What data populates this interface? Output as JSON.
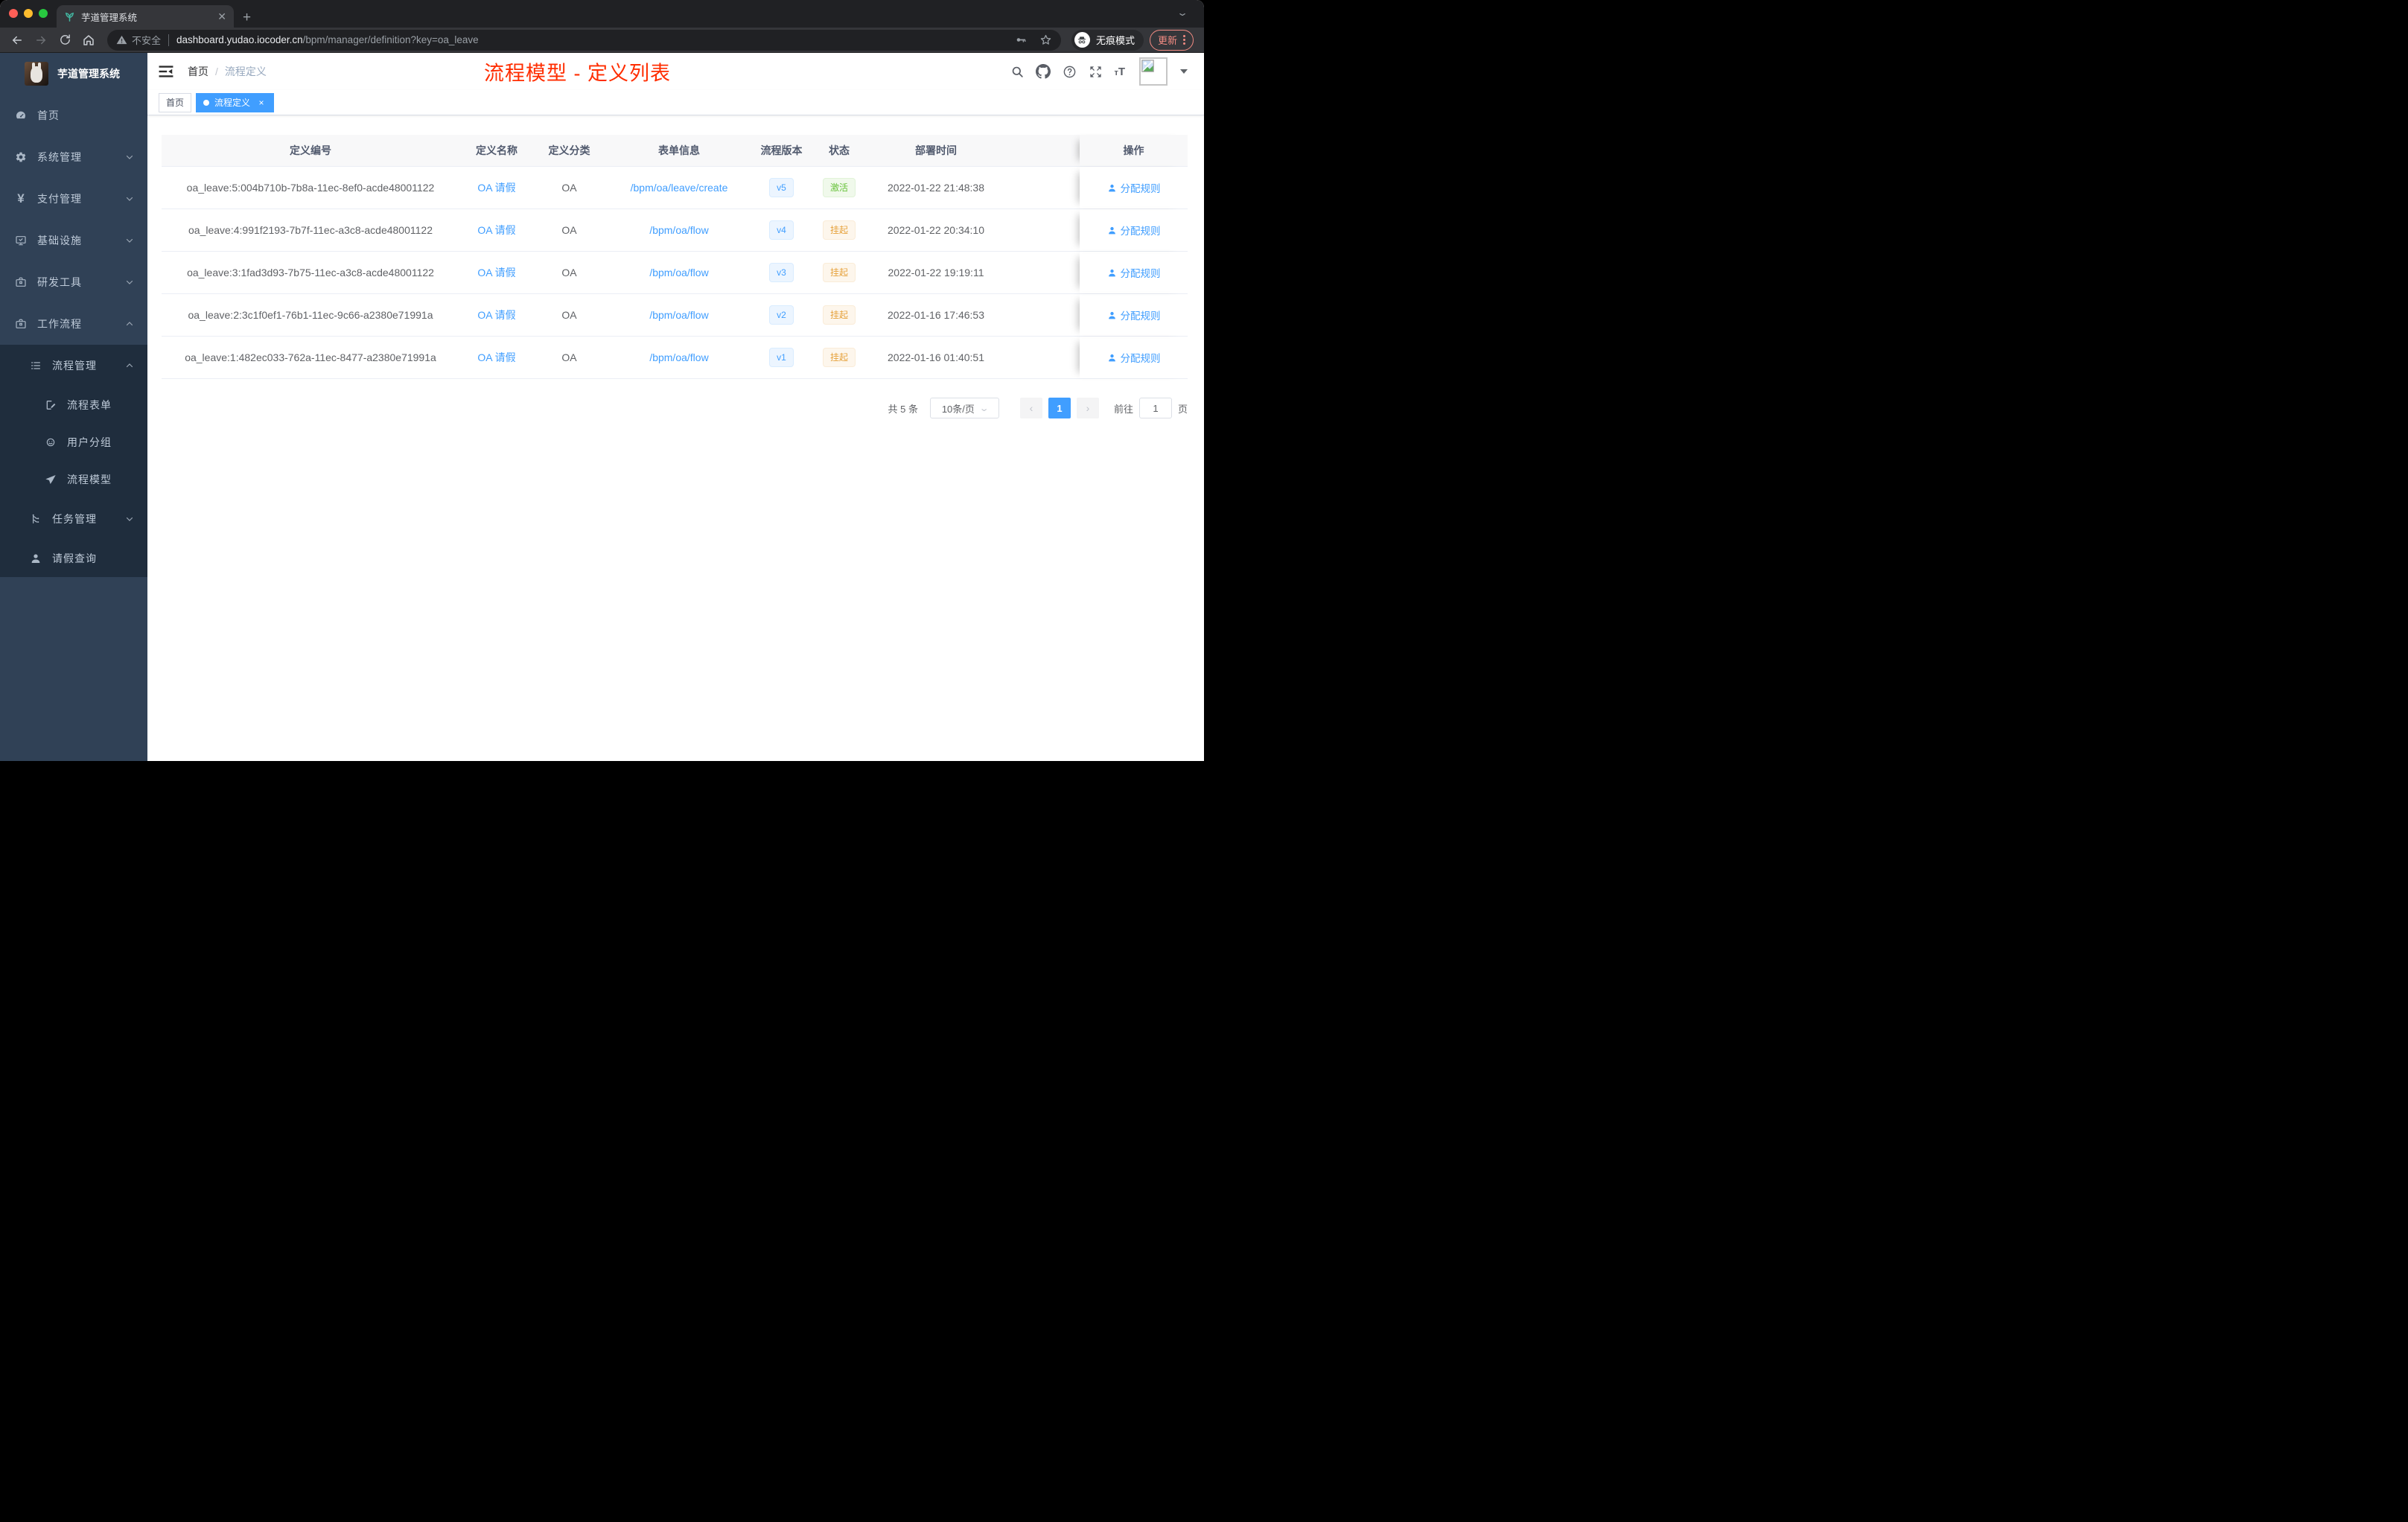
{
  "browser": {
    "tab_title": "芋道管理系统",
    "new_tab": "+",
    "security_label": "不安全",
    "url_domain": "dashboard.yudao.iocoder.cn",
    "url_path": "/bpm/manager/definition?key=oa_leave",
    "incognito_label": "无痕模式",
    "update_label": "更新"
  },
  "sidebar": {
    "logo_title": "芋道管理系统",
    "items": [
      {
        "label": "首页",
        "icon": "dashboard-icon",
        "chevron": ""
      },
      {
        "label": "系统管理",
        "icon": "gear-icon",
        "chevron": "down"
      },
      {
        "label": "支付管理",
        "icon": "yen-icon",
        "chevron": "down"
      },
      {
        "label": "基础设施",
        "icon": "monitor-icon",
        "chevron": "down"
      },
      {
        "label": "研发工具",
        "icon": "toolbox-icon",
        "chevron": "down"
      },
      {
        "label": "工作流程",
        "icon": "briefcase-icon",
        "chevron": "up"
      },
      {
        "label": "流程管理",
        "icon": "list-icon",
        "chevron": "up"
      },
      {
        "label": "流程表单",
        "icon": "form-icon",
        "chevron": ""
      },
      {
        "label": "用户分组",
        "icon": "user-group-icon",
        "chevron": ""
      },
      {
        "label": "流程模型",
        "icon": "paper-plane-icon",
        "chevron": ""
      },
      {
        "label": "任务管理",
        "icon": "tree-icon",
        "chevron": "down"
      },
      {
        "label": "请假查询",
        "icon": "person-icon",
        "chevron": ""
      }
    ]
  },
  "header": {
    "breadcrumb_home": "首页",
    "breadcrumb_separator": "/",
    "breadcrumb_current": "流程定义",
    "annotation": "流程模型 - 定义列表"
  },
  "tags": [
    {
      "label": "首页",
      "active": false
    },
    {
      "label": "流程定义",
      "active": true,
      "close": "×"
    }
  ],
  "table": {
    "columns": [
      "定义编号",
      "定义名称",
      "定义分类",
      "表单信息",
      "流程版本",
      "状态",
      "部署时间",
      "操作"
    ],
    "rows": [
      {
        "id": "oa_leave:5:004b710b-7b8a-11ec-8ef0-acde48001122",
        "name": "OA 请假",
        "category": "OA",
        "form": "/bpm/oa/leave/create",
        "version": "v5",
        "status": "激活",
        "status_type": "success",
        "time": "2022-01-22 21:48:38",
        "action": "分配规则"
      },
      {
        "id": "oa_leave:4:991f2193-7b7f-11ec-a3c8-acde48001122",
        "name": "OA 请假",
        "category": "OA",
        "form": "/bpm/oa/flow",
        "version": "v4",
        "status": "挂起",
        "status_type": "warning",
        "time": "2022-01-22 20:34:10",
        "action": "分配规则"
      },
      {
        "id": "oa_leave:3:1fad3d93-7b75-11ec-a3c8-acde48001122",
        "name": "OA 请假",
        "category": "OA",
        "form": "/bpm/oa/flow",
        "version": "v3",
        "status": "挂起",
        "status_type": "warning",
        "time": "2022-01-22 19:19:11",
        "action": "分配规则"
      },
      {
        "id": "oa_leave:2:3c1f0ef1-76b1-11ec-9c66-a2380e71991a",
        "name": "OA 请假",
        "category": "OA",
        "form": "/bpm/oa/flow",
        "version": "v2",
        "status": "挂起",
        "status_type": "warning",
        "time": "2022-01-16 17:46:53",
        "action": "分配规则"
      },
      {
        "id": "oa_leave:1:482ec033-762a-11ec-8477-a2380e71991a",
        "name": "OA 请假",
        "category": "OA",
        "form": "/bpm/oa/flow",
        "version": "v1",
        "status": "挂起",
        "status_type": "warning",
        "time": "2022-01-16 01:40:51",
        "action": "分配规则"
      }
    ]
  },
  "pagination": {
    "total_label": "共 5 条",
    "page_size": "10条/页",
    "prev": "‹",
    "current_page": "1",
    "next": "›",
    "goto_label": "前往",
    "goto_value": "1",
    "page_unit": "页"
  },
  "colors": {
    "accent": "#409eff",
    "success": "#67c23a",
    "warning": "#e6a23c",
    "annotation_red": "#ff2d00",
    "sidebar_bg": "#304156",
    "submenu_bg": "#1f2d3d"
  }
}
